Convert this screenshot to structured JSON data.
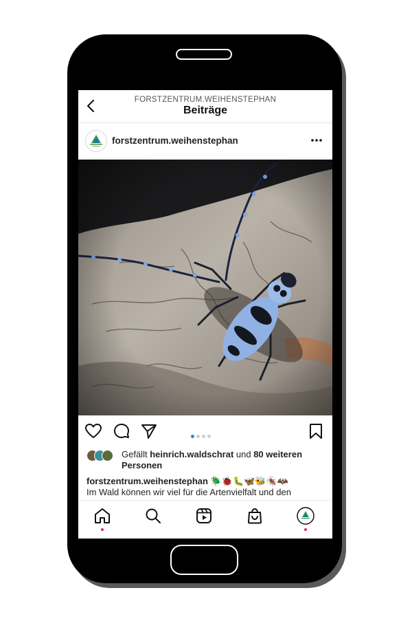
{
  "header": {
    "back_icon": "chevron-left-icon",
    "username": "FORSTZENTRUM.WEIHENSTEPHAN",
    "title": "Beiträge"
  },
  "post": {
    "username": "forstzentrum.weihenstephan",
    "more_icon": "three-dots-icon",
    "image_subject": "Alpenbock beetle on tree bark",
    "carousel": {
      "count": 4,
      "active": 1
    },
    "actions": [
      "heart-icon",
      "comment-icon",
      "share-icon",
      "bookmark-icon"
    ],
    "likes": {
      "prefix": "Gefällt ",
      "user": "heinrich.waldschrat",
      "middle": " und ",
      "count_text": "80 weiteren Personen"
    },
    "caption": {
      "user": "forstzentrum.weihenstephan",
      "emojis": " 🪲🐞🐛🦋🐝🪳🦇",
      "text": "Im Wald können wir viel für die Artenvielfalt und den"
    }
  },
  "nav": {
    "items": [
      "home-icon",
      "search-icon",
      "reels-icon",
      "shop-icon",
      "profile-icon"
    ]
  },
  "colors": {
    "accent_blue": "#1d8fe1",
    "notify_red": "#e0245e"
  }
}
